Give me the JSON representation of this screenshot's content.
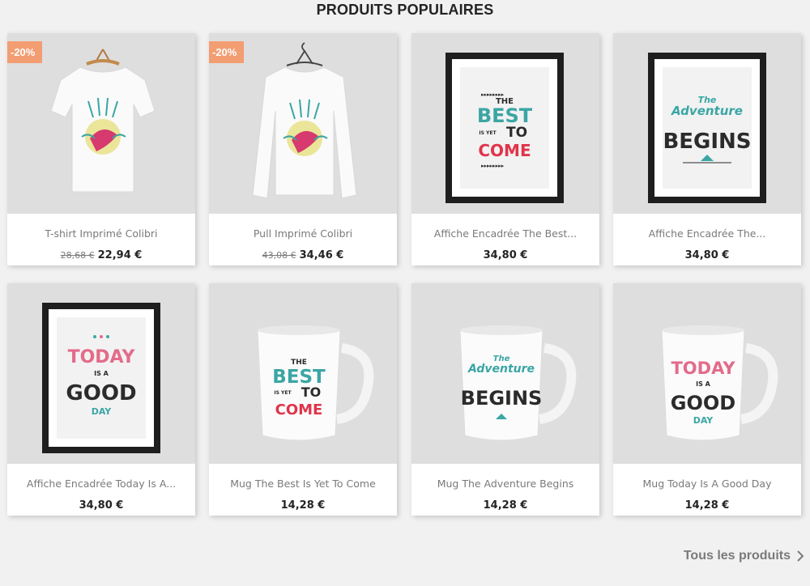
{
  "section_title": "PRODUITS POPULAIRES",
  "products": [
    {
      "name": "T-shirt Imprimé Colibri",
      "old_price": "28,68 €",
      "price": "22,94 €",
      "badge": "-20%",
      "image": "tshirt-hummingbird"
    },
    {
      "name": "Pull Imprimé Colibri",
      "old_price": "43,08 €",
      "price": "34,46 €",
      "badge": "-20%",
      "image": "sweater-hummingbird"
    },
    {
      "name": "Affiche Encadrée The Best...",
      "price": "34,80 €",
      "image": "framed-poster-best-yet-to-come"
    },
    {
      "name": "Affiche Encadrée The...",
      "price": "34,80 €",
      "image": "framed-poster-adventure-begins"
    },
    {
      "name": "Affiche Encadrée Today Is A...",
      "price": "34,80 €",
      "image": "framed-poster-today-good-day"
    },
    {
      "name": "Mug The Best Is Yet To Come",
      "price": "14,28 €",
      "image": "mug-best-yet-to-come"
    },
    {
      "name": "Mug The Adventure Begins",
      "price": "14,28 €",
      "image": "mug-adventure-begins"
    },
    {
      "name": "Mug Today Is A Good Day",
      "price": "14,28 €",
      "image": "mug-today-good-day"
    }
  ],
  "artwork": {
    "best": {
      "the": "THE",
      "best": "BEST",
      "is_yet": "IS YET",
      "to": "TO",
      "come": "COME"
    },
    "adventure": {
      "the": "The",
      "adventure": "Adventure",
      "begins": "BEGINS"
    },
    "today": {
      "today": "TODAY",
      "is_a": "IS A",
      "good": "GOOD",
      "day": "DAY"
    }
  },
  "all_products_link": "Tous les produits",
  "colors": {
    "badge": "#f39d72",
    "teal": "#3aa6a4",
    "red": "#e0344a",
    "pink": "#e36b8a",
    "dark": "#2b2b2b"
  }
}
